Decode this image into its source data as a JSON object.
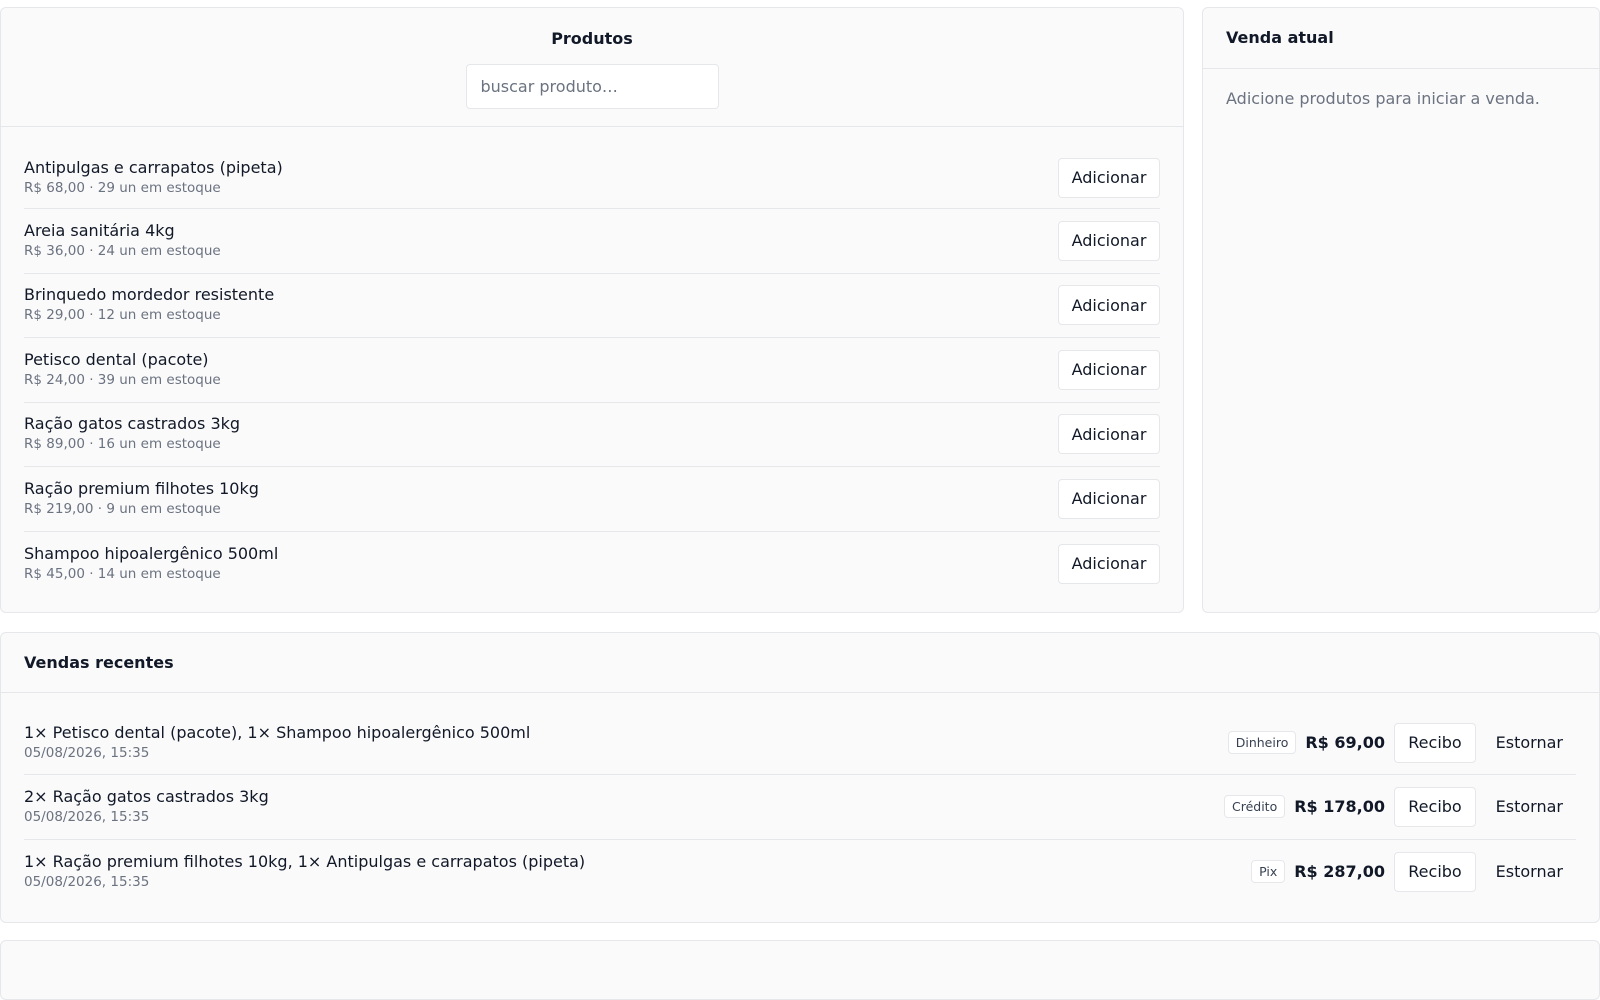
{
  "products": {
    "title": "Produtos",
    "search_placeholder": "buscar produto…",
    "add_label": "Adicionar",
    "items": [
      {
        "name": "Antipulgas e carrapatos (pipeta)",
        "meta": "R$ 68,00 · 29 un em estoque"
      },
      {
        "name": "Areia sanitária 4kg",
        "meta": "R$ 36,00 · 24 un em estoque"
      },
      {
        "name": "Brinquedo mordedor resistente",
        "meta": "R$ 29,00 · 12 un em estoque"
      },
      {
        "name": "Petisco dental (pacote)",
        "meta": "R$ 24,00 · 39 un em estoque"
      },
      {
        "name": "Ração gatos castrados 3kg",
        "meta": "R$ 89,00 · 16 un em estoque"
      },
      {
        "name": "Ração premium filhotes 10kg",
        "meta": "R$ 219,00 · 9 un em estoque"
      },
      {
        "name": "Shampoo hipoalergênico 500ml",
        "meta": "R$ 45,00 · 14 un em estoque"
      }
    ]
  },
  "current_sale": {
    "title": "Venda atual",
    "empty_message": "Adicione produtos para iniciar a venda."
  },
  "recent_sales": {
    "title": "Vendas recentes",
    "receipt_label": "Recibo",
    "refund_label": "Estornar",
    "items": [
      {
        "description": "1× Petisco dental (pacote), 1× Shampoo hipoalergênico 500ml",
        "datetime": "05/08/2026, 15:35",
        "method": "Dinheiro",
        "total": "R$ 69,00"
      },
      {
        "description": "2× Ração gatos castrados 3kg",
        "datetime": "05/08/2026, 15:35",
        "method": "Crédito",
        "total": "R$ 178,00"
      },
      {
        "description": "1× Ração premium filhotes 10kg, 1× Antipulgas e carrapatos (pipeta)",
        "datetime": "05/08/2026, 15:35",
        "method": "Pix",
        "total": "R$ 287,00"
      }
    ]
  }
}
